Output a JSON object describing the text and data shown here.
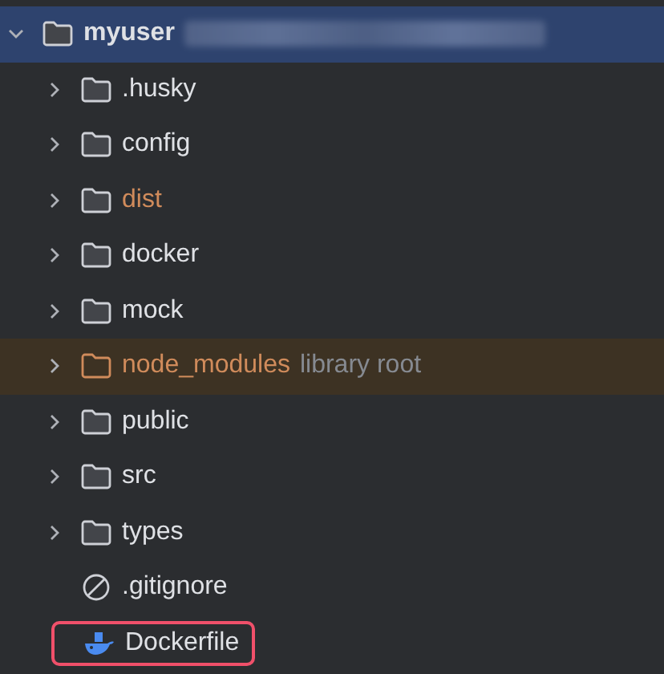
{
  "tree": {
    "name": "myuser",
    "kind": "folder",
    "expanded": true,
    "selected": true,
    "children": [
      {
        "name": ".husky",
        "kind": "folder",
        "expanded": false,
        "selected": false
      },
      {
        "name": "config",
        "kind": "folder",
        "expanded": false,
        "selected": false
      },
      {
        "name": "dist",
        "kind": "folder",
        "expanded": false,
        "selected": false,
        "color": "#d08b5b"
      },
      {
        "name": "docker",
        "kind": "folder",
        "expanded": false,
        "selected": false
      },
      {
        "name": "mock",
        "kind": "folder",
        "expanded": false,
        "selected": false
      },
      {
        "name": "node_modules",
        "kind": "folder",
        "expanded": false,
        "selected": false,
        "color": "#d08b5b",
        "library": true,
        "note": "library root"
      },
      {
        "name": "public",
        "kind": "folder",
        "expanded": false,
        "selected": false
      },
      {
        "name": "src",
        "kind": "folder",
        "expanded": false,
        "selected": false
      },
      {
        "name": "types",
        "kind": "folder",
        "expanded": false,
        "selected": false
      },
      {
        "name": ".gitignore",
        "kind": "ignore",
        "selected": false
      },
      {
        "name": "Dockerfile",
        "kind": "docker",
        "selected": false,
        "highlighted": true
      }
    ]
  }
}
